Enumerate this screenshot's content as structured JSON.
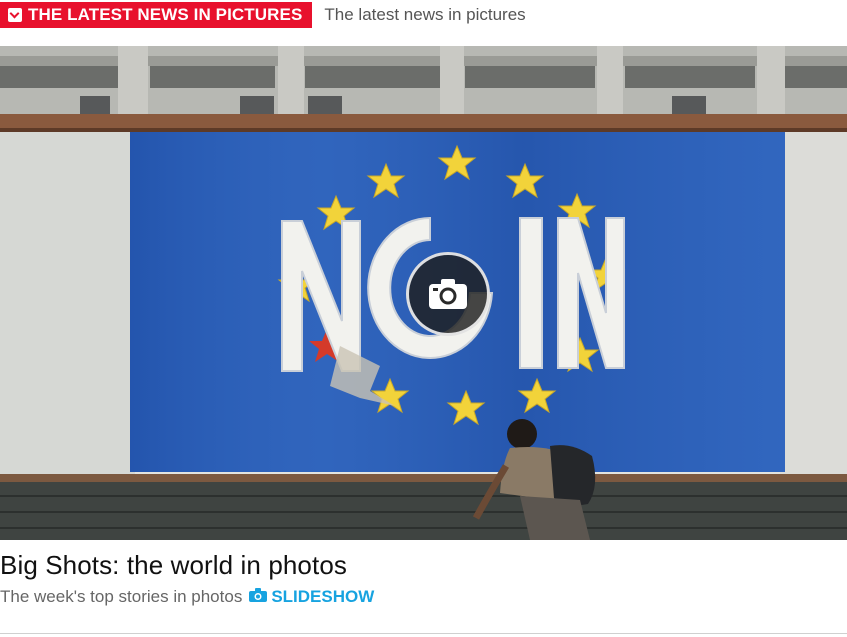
{
  "header": {
    "badge_label": "THE LATEST NEWS IN PICTURES",
    "subheading": "The latest news in pictures"
  },
  "photo": {
    "mural_text": "NOIN"
  },
  "caption": {
    "title": "Big Shots: the world in photos",
    "subtitle": "The week's top stories in photos",
    "slideshow_label": "SLIDESHOW"
  },
  "colors": {
    "badge_red": "#e8112d",
    "link_blue": "#17a3e0",
    "mural_blue": "#2c5fb8",
    "star_yellow": "#f2d33a"
  },
  "icons": [
    "check-square-icon",
    "camera-icon",
    "camera-small-icon"
  ]
}
